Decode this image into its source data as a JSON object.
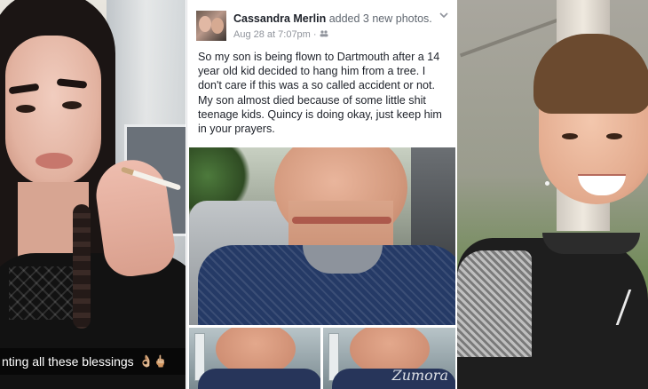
{
  "left_panel": {
    "caption": "nting all these blessings",
    "caption_emoji": "👌🏼🖕🏼"
  },
  "post": {
    "author": "Cassandra Merlin",
    "action": "added 3 new photos.",
    "timestamp": "Aug 28 at 7:07pm",
    "separator": "·",
    "audience_icon": "friends-icon",
    "dropdown_icon": "chevron-down-icon",
    "body": "So my son is being flown to Dartmouth after a 14 year old kid decided to hang him from a tree. I don't care if this was a so called accident or not. My son almost died because of some little shit teenage kids. Quincy is doing okay, just keep him in your prayers.",
    "watermark": "Zumora"
  },
  "colors": {
    "text_primary": "#1d2129",
    "text_secondary": "#90949c",
    "border": "#dddfe2"
  }
}
